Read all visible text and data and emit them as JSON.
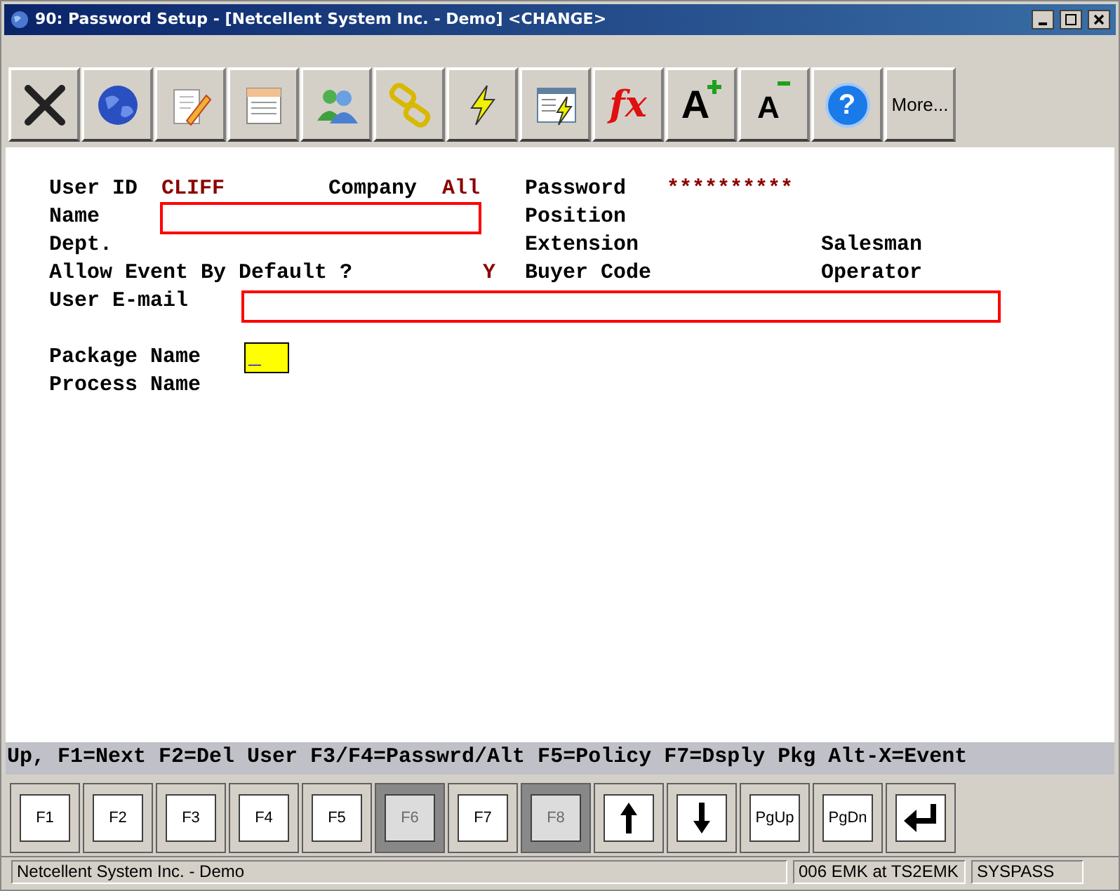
{
  "window": {
    "title": "90: Password Setup - [Netcellent System Inc. - Demo] <CHANGE>"
  },
  "toolbar": [
    {
      "kind": "close"
    },
    {
      "kind": "globe"
    },
    {
      "kind": "edit"
    },
    {
      "kind": "notepad"
    },
    {
      "kind": "users"
    },
    {
      "kind": "link"
    },
    {
      "kind": "lightning"
    },
    {
      "kind": "window-lightning"
    },
    {
      "kind": "formula",
      "label": "fx"
    },
    {
      "kind": "font-larger",
      "label": "A"
    },
    {
      "kind": "font-smaller",
      "label": "A"
    },
    {
      "kind": "help",
      "label": "?"
    },
    {
      "kind": "more",
      "label": "More..."
    }
  ],
  "form": {
    "user_id": {
      "label": "User ID",
      "value": "CLIFF"
    },
    "company": {
      "label": "Company",
      "value": "All"
    },
    "password": {
      "label": "Password",
      "value": "**********"
    },
    "name": {
      "label": "Name"
    },
    "position": {
      "label": "Position"
    },
    "dept": {
      "label": "Dept."
    },
    "extension": {
      "label": "Extension"
    },
    "salesman": {
      "label": "Salesman"
    },
    "allow_event": {
      "label": "Allow Event By Default ?",
      "value": "Y"
    },
    "buyer_code": {
      "label": "Buyer Code"
    },
    "operator": {
      "label": "Operator"
    },
    "user_email": {
      "label": "User E-mail"
    },
    "package_name": {
      "label": "Package Name",
      "value": "_"
    },
    "process_name": {
      "label": "Process Name"
    }
  },
  "hint_bar": "Up, F1=Next F2=Del User F3/F4=Passwrd/Alt F5=Policy F7=Dsply Pkg Alt-X=Event",
  "function_keys": [
    {
      "kind": "text",
      "label": "F1",
      "disabled": false
    },
    {
      "kind": "text",
      "label": "F2",
      "disabled": false
    },
    {
      "kind": "text",
      "label": "F3",
      "disabled": false
    },
    {
      "kind": "text",
      "label": "F4",
      "disabled": false
    },
    {
      "kind": "text",
      "label": "F5",
      "disabled": false
    },
    {
      "kind": "text",
      "label": "F6",
      "disabled": true
    },
    {
      "kind": "text",
      "label": "F7",
      "disabled": false
    },
    {
      "kind": "text",
      "label": "F8",
      "disabled": true
    },
    {
      "kind": "up",
      "disabled": false
    },
    {
      "kind": "down",
      "disabled": false
    },
    {
      "kind": "text",
      "label": "PgUp",
      "disabled": false
    },
    {
      "kind": "text",
      "label": "PgDn",
      "disabled": false
    },
    {
      "kind": "enter",
      "disabled": false
    }
  ],
  "status_bar": [
    "Netcellent System Inc. - Demo",
    "006 EMK at TS2EMK",
    "SYSPASS"
  ]
}
